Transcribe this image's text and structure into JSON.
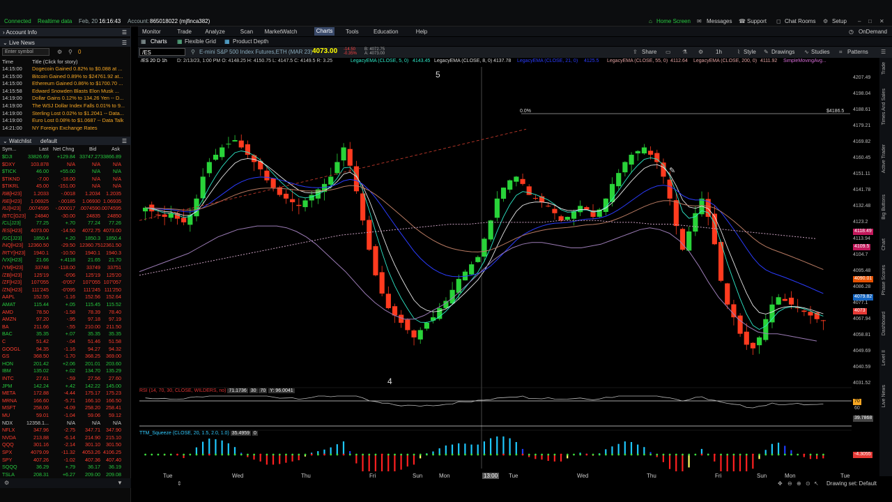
{
  "topbar": {
    "connection": "Connected",
    "realtime": "Realtime data",
    "date": "Feb, 20",
    "time": "16:16:43",
    "account_label": "Account:",
    "account": "865018022 (mjfinca382)",
    "home_screen": "Home Screen",
    "messages": "Messages",
    "support": "Support",
    "chat_rooms": "Chat Rooms",
    "setup": "Setup"
  },
  "left": {
    "account_info": "Account Info",
    "live_news": "Live News",
    "symbol_placeholder": "Enter symbol",
    "news_count": "0",
    "news_headers": {
      "time": "Time",
      "title": "Title (Click for story)"
    },
    "news": [
      {
        "time": "14:15:00",
        "title": "Dogecoin Gained 0.82% to $0.088 at ..."
      },
      {
        "time": "14:15:00",
        "title": "Bitcoin Gained 0.89% to $24761.92 at..."
      },
      {
        "time": "14:15:00",
        "title": "Ethereum Gained 0.86% to $1700.70 ..."
      },
      {
        "time": "14:15:58",
        "title": "Edward Snowden Blasts Elon Musk ..."
      },
      {
        "time": "14:19:00",
        "title": "Dollar Gains 0.12% to 134.26 Yen -- D..."
      },
      {
        "time": "14:19:00",
        "title": "The WSJ Dollar Index Falls 0.01% to 9..."
      },
      {
        "time": "14:19:00",
        "title": "Sterling Lost 0.02% to $1.2041 -- Data..."
      },
      {
        "time": "14:19:00",
        "title": "Euro Lost 0.08% to $1.0687 -- Data Talk"
      },
      {
        "time": "14:21:00",
        "title": "NY Foreign Exchange Rates"
      }
    ],
    "watchlist_title": "Watchlist",
    "watchlist_name": "default",
    "watch_headers": {
      "sym": "Sym...",
      "last": "Last",
      "chg": "Net Chng",
      "bid": "Bid",
      "ask": "Ask"
    },
    "watchlist": [
      {
        "sym": "$DJI",
        "last": "33826.69",
        "chg": "+129.84",
        "bid": "33747.27",
        "ask": "33866.89",
        "dir": "up"
      },
      {
        "sym": "$DXY",
        "last": "103.878",
        "chg": "N/A",
        "bid": "N/A",
        "ask": "N/A",
        "dir": "dn"
      },
      {
        "sym": "$TICK",
        "last": "46.00",
        "chg": "+55.00",
        "bid": "N/A",
        "ask": "N/A",
        "dir": "up"
      },
      {
        "sym": "$TIKND",
        "last": "-7.00",
        "chg": "-18.00",
        "bid": "N/A",
        "ask": "N/A",
        "dir": "dn"
      },
      {
        "sym": "$TIKRL",
        "last": "45.00",
        "chg": "-151.00",
        "bid": "N/A",
        "ask": "N/A",
        "dir": "dn"
      },
      {
        "sym": "/6B[H23]",
        "last": "1.2033",
        "chg": "-.0018",
        "bid": "1.2034",
        "ask": "1.2035",
        "dir": "dn"
      },
      {
        "sym": "/6E[H23]",
        "last": "1.06925",
        "chg": "-.00185",
        "bid": "1.06930",
        "ask": "1.06935",
        "dir": "dn"
      },
      {
        "sym": "/6J[H23]",
        "last": ".0074595",
        "chg": "-.000017",
        "bid": ".0074590",
        ",ask": ".0074595",
        "ask": ".0074595",
        "dir": "dn"
      },
      {
        "sym": "/BTC[G23]",
        "last": "24840",
        "chg": "-30.00",
        "bid": "24835",
        "ask": "24850",
        "dir": "dn"
      },
      {
        "sym": "/CL[J23]",
        "last": "77.25",
        "chg": "+.70",
        "bid": "77.24",
        "ask": "77.26",
        "dir": "up"
      },
      {
        "sym": "/ES[H23]",
        "last": "4073.00",
        "chg": "-14.50",
        "bid": "4072.75",
        "ask": "4073.00",
        "dir": "dn"
      },
      {
        "sym": "/GC[J23]",
        "last": "1850.4",
        "chg": "+.20",
        "bid": "1850.3",
        "ask": "1850.4",
        "dir": "up"
      },
      {
        "sym": "/NQ[H23]",
        "last": "12360.50",
        "chg": "-29.50",
        "bid": "12360.75",
        "ask": "12361.50",
        "dir": "dn"
      },
      {
        "sym": "/RTY[H23]",
        "last": "1940.1",
        "chg": "-10.50",
        "bid": "1940.1",
        "ask": "1940.3",
        "dir": "dn"
      },
      {
        "sym": "/VX[H23]",
        "last": "21.66",
        "chg": "+.4118",
        "bid": "21.65",
        "ask": "21.70",
        "dir": "up"
      },
      {
        "sym": "/YM[H23]",
        "last": "33748",
        "chg": "-118.00",
        "bid": "33749",
        "ask": "33751",
        "dir": "dn"
      },
      {
        "sym": "/ZB[H23]",
        "last": "125'19",
        "chg": "-0'06",
        "bid": "125'19",
        "ask": "125'20",
        "dir": "dn"
      },
      {
        "sym": "/ZF[H23]",
        "last": "107'055",
        "chg": "-0'057",
        "bid": "107'055",
        "ask": "107'057",
        "dir": "dn"
      },
      {
        "sym": "/ZN[H23]",
        "last": "111'245",
        "chg": "-0'095",
        "bid": "111'245",
        "ask": "111'250",
        "dir": "dn"
      },
      {
        "sym": "AAPL",
        "last": "152.55",
        "chg": "-1.16",
        "bid": "152.56",
        "ask": "152.64",
        "dir": "dn"
      },
      {
        "sym": "AMAT",
        "last": "115.44",
        "chg": "+.05",
        "bid": "115.45",
        "ask": "115.52",
        "dir": "up"
      },
      {
        "sym": "AMD",
        "last": "78.50",
        "chg": "-1.58",
        "bid": "78.39",
        "ask": "78.40",
        "dir": "dn"
      },
      {
        "sym": "AMZN",
        "last": "97.20",
        "chg": "-.95",
        "bid": "97.18",
        "ask": "97.19",
        "dir": "dn"
      },
      {
        "sym": "BA",
        "last": "211.66",
        "chg": "-.55",
        "bid": "210.00",
        "ask": "211.50",
        "dir": "dn"
      },
      {
        "sym": "BAC",
        "last": "35.35",
        "chg": "+.07",
        "bid": "35.35",
        "ask": "35.35",
        "dir": "up"
      },
      {
        "sym": "C",
        "last": "51.42",
        "chg": "-.04",
        "bid": "51.46",
        "ask": "51.58",
        "dir": "dn"
      },
      {
        "sym": "GOOGL",
        "last": "94.35",
        "chg": "-1.16",
        "bid": "94.27",
        "ask": "94.32",
        "dir": "dn"
      },
      {
        "sym": "GS",
        "last": "368.50",
        "chg": "-1.70",
        "bid": "368.25",
        "ask": "369.00",
        "dir": "dn"
      },
      {
        "sym": "HON",
        "last": "201.42",
        "chg": "+2.06",
        "bid": "201.01",
        "ask": "203.60",
        "dir": "up"
      },
      {
        "sym": "IBM",
        "last": "135.02",
        "chg": "+.02",
        "bid": "134.70",
        "ask": "135.29",
        "dir": "up"
      },
      {
        "sym": "INTC",
        "last": "27.61",
        "chg": "-.59",
        "bid": "27.56",
        "ask": "27.60",
        "dir": "dn"
      },
      {
        "sym": "JPM",
        "last": "142.24",
        "chg": "+.42",
        "bid": "142.22",
        "ask": "145.00",
        "dir": "up"
      },
      {
        "sym": "META",
        "last": "172.88",
        "chg": "-4.44",
        "bid": "175.17",
        "ask": "175.23",
        "dir": "dn"
      },
      {
        "sym": "MRNA",
        "last": "166.60",
        "chg": "-5.71",
        "bid": "166.10",
        "ask": "166.50",
        "dir": "dn"
      },
      {
        "sym": "MSFT",
        "last": "258.06",
        "chg": "-4.09",
        "bid": "258.20",
        "ask": "258.41",
        "dir": "dn"
      },
      {
        "sym": "MU",
        "last": "59.01",
        "chg": "-1.04",
        "bid": "59.06",
        "ask": "59.12",
        "dir": "dn"
      },
      {
        "sym": "NDX",
        "last": "12358.1...",
        "chg": "N/A",
        "bid": "N/A",
        "ask": "N/A",
        "dir": "flat"
      },
      {
        "sym": "NFLX",
        "last": "347.96",
        "chg": "-2.75",
        "bid": "347.71",
        "ask": "347.90",
        "dir": "dn"
      },
      {
        "sym": "NVDA",
        "last": "213.88",
        "chg": "-6.14",
        "bid": "214.90",
        "ask": "215.10",
        "dir": "dn"
      },
      {
        "sym": "QQQ",
        "last": "301.16",
        "chg": "-2.14",
        "bid": "301.10",
        "ask": "301.50",
        "dir": "dn"
      },
      {
        "sym": "SPX",
        "last": "4079.09",
        "chg": "-11.32",
        "bid": "4053.26",
        "ask": "4106.25",
        "dir": "dn"
      },
      {
        "sym": "SPY",
        "last": "407.26",
        "chg": "-1.02",
        "bid": "407.36",
        "ask": "407.40",
        "dir": "dn"
      },
      {
        "sym": "SQQQ",
        "last": "36.29",
        "chg": "+.79",
        "bid": "36.17",
        "ask": "36.19",
        "dir": "up"
      },
      {
        "sym": "TSLA",
        "last": "208.31",
        "chg": "+6.27",
        "bid": "209.00",
        "ask": "209.08",
        "dir": "up"
      }
    ]
  },
  "menu": [
    "Monitor",
    "Trade",
    "Analyze",
    "Scan",
    "MarketWatch",
    "Charts",
    "Tools",
    "Education",
    "Help"
  ],
  "ondemand": "OnDemand",
  "subtabs": {
    "charts": "Charts",
    "flexible_grid": "Flexible Grid",
    "product_depth": "Product Depth"
  },
  "chartbar": {
    "symbol": "/ES",
    "description": "E-mini S&P 500 Index Futures,ETH (MAR 23)",
    "price": "4073.00",
    "change": "-14.50",
    "change_pct": "-0.35%",
    "bid": "B: 4072.75",
    "ask": "A: 4073.00",
    "share": "Share",
    "timeframe": "1h",
    "style": "Style",
    "drawings": "Drawings",
    "studies": "Studies",
    "patterns": "Patterns"
  },
  "legend": {
    "info": "/ES 20 D 1h",
    "ohlc": "D: 2/13/23, 1:00 PM  O: 4148.25  H: 4150.75  L: 4147.5  C: 4149.5  R: 3.25",
    "ema5": "LegacyEMA (CLOSE, 5, 0)",
    "ema5v": "4143.45",
    "ema8": "LegacyEMA (CLOSE, 8, 0)",
    "ema8v": "4137.78",
    "ema21": "LegacyEMA (CLOSE, 21, 0)",
    "ema21v": "4125.5",
    "ema55": "LegacyEMA (CLOSE, 55, 0)",
    "ema55v": "4112.64",
    "ema200": "LegacyEMA (CLOSE, 200, 0)",
    "ema200v": "4111.92",
    "sma": "SimpleMovingAvg..."
  },
  "price_scale": [
    "4207.49",
    "4198.04",
    "4188.61",
    "4179.21",
    "4169.82",
    "4160.45",
    "4151.11",
    "4141.78",
    "4132.48",
    "4123.2",
    "4113.94",
    "4104.7",
    "4095.48",
    "4086.28",
    "4077.1",
    "4067.94",
    "4058.81",
    "4049.69",
    "4040.59",
    "4031.52"
  ],
  "price_tags": [
    {
      "label": "4118.49",
      "color": "#c2185b"
    },
    {
      "label": "4109.5",
      "color": "#c2185b"
    },
    {
      "label": "4090.01",
      "color": "#e65100"
    },
    {
      "label": "4079.82",
      "color": "#1565c0"
    },
    {
      "label": "4073",
      "color": "#e53935"
    }
  ],
  "fib": {
    "pct": "0.0%",
    "level": "$4186.5"
  },
  "wave_labels": [
    "5",
    "4"
  ],
  "rsi": {
    "header": "RSI (14, 70, 30, CLOSE, WILDERS, no)",
    "value": "71.1736",
    "ob": "30",
    "os": "70",
    "y": "Y: 96.0041",
    "scale": [
      "60",
      "39.7868"
    ],
    "tag": "70"
  },
  "ttm": {
    "header": "TTM_Squeeze (CLOSE, 20, 1.5, 2.0, 1.0)",
    "value": "35.4959",
    "zero": "0",
    "tag": "-4.3055"
  },
  "time_axis": [
    "Tue",
    "Wed",
    "Thu",
    "Fri",
    "Sun",
    "Mon",
    "13:00",
    "Tue",
    "Wed",
    "Thu",
    "Fri",
    "Sun",
    "Mon",
    "Tue"
  ],
  "bottom": {
    "drawing_set": "Drawing set: Default"
  },
  "right_tabs": [
    "Trade",
    "Times And Sales",
    "Active Trader",
    "Big Buttons",
    "Chart",
    "Phase Scores",
    "Dashboard",
    "Level II",
    "Live News"
  ],
  "chart_data": {
    "type": "candlestick",
    "symbol": "/ES",
    "interval": "1h",
    "ylim": [
      4031.52,
      4207.49
    ],
    "close_series": [
      4135,
      4133,
      4131,
      4130,
      4132,
      4129,
      4127,
      4131,
      4140,
      4152,
      4160,
      4164,
      4168,
      4170,
      4172,
      4168,
      4164,
      4160,
      4156,
      4150,
      4146,
      4142,
      4140,
      4138,
      4136,
      4139,
      4142,
      4145,
      4148,
      4152,
      4160,
      4168,
      4158,
      4144,
      4128,
      4112,
      4098,
      4088,
      4080,
      4076,
      4072,
      4068,
      4064,
      4068,
      4072,
      4075,
      4080,
      4084,
      4090,
      4096,
      4100,
      4104,
      4108,
      4118,
      4128,
      4140,
      4146,
      4150,
      4152,
      4148,
      4142,
      4140,
      4138,
      4136,
      4132,
      4128,
      4130,
      4133,
      4136,
      4134,
      4130,
      4134,
      4140,
      4148,
      4154,
      4160,
      4164,
      4166,
      4168,
      4164,
      4160,
      4152,
      4140,
      4125,
      4112,
      4122,
      4132,
      4140,
      4130,
      4115,
      4095,
      4082,
      4075,
      4066,
      4060,
      4058,
      4064,
      4074,
      4082,
      4086,
      4084,
      4082,
      4080,
      4078,
      4076,
      4074,
      4073
    ],
    "ema21": [
      4118,
      4120,
      4122,
      4124,
      4126,
      4128,
      4131,
      4134,
      4137,
      4139,
      4141,
      4142,
      4143,
      4143,
      4143,
      4142,
      4140,
      4137,
      4133,
      4128,
      4123,
      4118,
      4112,
      4106,
      4101,
      4097,
      4094,
      4092,
      4092,
      4094,
      4097,
      4100,
      4104,
      4109,
      4114,
      4119,
      4124,
      4128,
      4131,
      4133,
      4134,
      4134,
      4133,
      4132,
      4131,
      4131,
      4132,
      4133,
      4135,
      4137,
      4139,
      4141,
      4142,
      4141,
      4139,
      4135,
      4129,
      4121,
      4112,
      4104,
      4098,
      4092,
      4088,
      4085,
      4084,
      4084,
      4083,
      4082,
      4081,
      4080
    ],
    "ema200": [
      4098,
      4100,
      4102,
      4104,
      4106,
      4108,
      4110,
      4112,
      4114,
      4116,
      4118,
      4120,
      4121,
      4122,
      4123,
      4124,
      4125,
      4126,
      4126,
      4127,
      4127,
      4127,
      4127,
      4128,
      4128,
      4128,
      4127,
      4127,
      4126,
      4126,
      4125,
      4124,
      4123,
      4122,
      4121,
      4120,
      4119,
      4118
    ]
  }
}
